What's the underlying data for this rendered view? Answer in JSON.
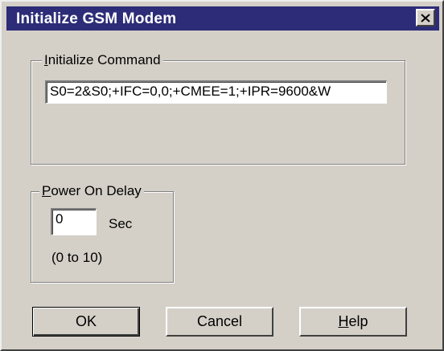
{
  "window": {
    "title": "Initialize GSM Modem",
    "close_icon": "close-icon"
  },
  "initialize_group": {
    "legend_first": "I",
    "legend_rest": "nitialize Command",
    "command_value": "S0=2&S0;+IFC=0,0;+CMEE=1;+IPR=9600&W"
  },
  "power_group": {
    "legend_first": "P",
    "legend_rest": "ower On Delay",
    "delay_value": "0",
    "unit_label": "Sec",
    "range_label": "(0 to 10)"
  },
  "buttons": {
    "ok_label": "OK",
    "cancel_label": "Cancel",
    "help_first": "H",
    "help_rest": "elp"
  },
  "colors": {
    "title_bar": "#2c2c78",
    "dialog_face": "#d4d0c8"
  }
}
